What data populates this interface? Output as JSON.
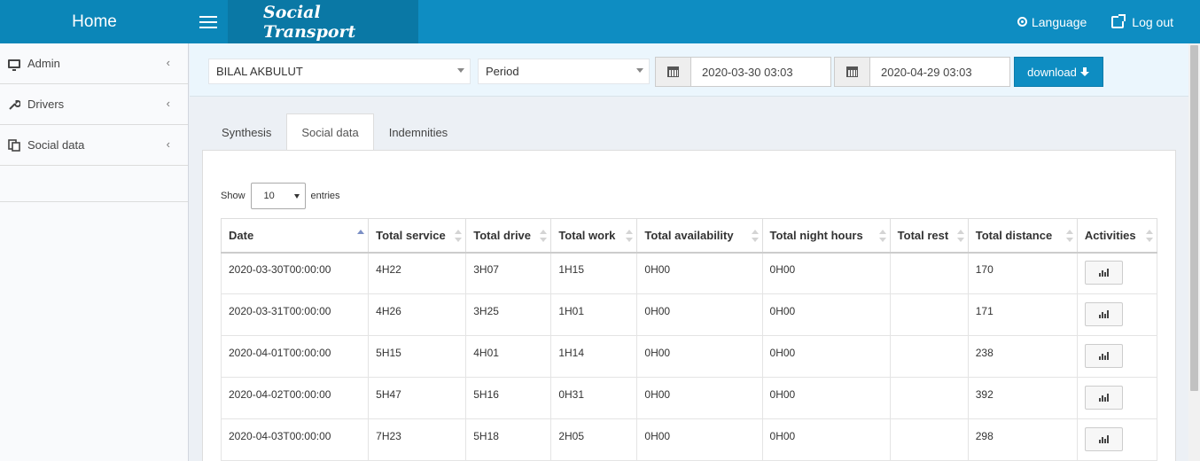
{
  "header": {
    "home_label": "Home",
    "app_title": "Social Transport",
    "language_label": "Language",
    "logout_label": "Log out"
  },
  "sidebar": {
    "items": [
      {
        "label": "Admin",
        "icon": "monitor-icon"
      },
      {
        "label": "Drivers",
        "icon": "wrench-icon"
      },
      {
        "label": "Social data",
        "icon": "copy-icon"
      }
    ]
  },
  "filters": {
    "driver": "BILAL AKBULUT",
    "period": "Period",
    "start_date": "2020-03-30 03:03",
    "end_date": "2020-04-29 03:03",
    "download_label": "download"
  },
  "tabs": [
    {
      "label": "Synthesis",
      "active": false
    },
    {
      "label": "Social data",
      "active": true
    },
    {
      "label": "Indemnities",
      "active": false
    }
  ],
  "length_menu": {
    "show_label": "Show",
    "value": "10",
    "entries_label": "entries"
  },
  "table": {
    "columns": [
      "Date",
      "Total service",
      "Total drive",
      "Total work",
      "Total availability",
      "Total night hours",
      "Total rest",
      "Total distance",
      "Activities"
    ],
    "rows": [
      [
        "2020-03-30T00:00:00",
        "4H22",
        "3H07",
        "1H15",
        "0H00",
        "0H00",
        "",
        "170"
      ],
      [
        "2020-03-31T00:00:00",
        "4H26",
        "3H25",
        "1H01",
        "0H00",
        "0H00",
        "",
        "171"
      ],
      [
        "2020-04-01T00:00:00",
        "5H15",
        "4H01",
        "1H14",
        "0H00",
        "0H00",
        "",
        "238"
      ],
      [
        "2020-04-02T00:00:00",
        "5H47",
        "5H16",
        "0H31",
        "0H00",
        "0H00",
        "",
        "392"
      ],
      [
        "2020-04-03T00:00:00",
        "7H23",
        "5H18",
        "2H05",
        "0H00",
        "0H00",
        "",
        "298"
      ]
    ]
  },
  "colors": {
    "header_bg": "#0e8dc2",
    "brand_bg": "#0b86b8",
    "logo_bg": "#0a78a5",
    "filter_bar_bg": "#ebf6fd"
  }
}
